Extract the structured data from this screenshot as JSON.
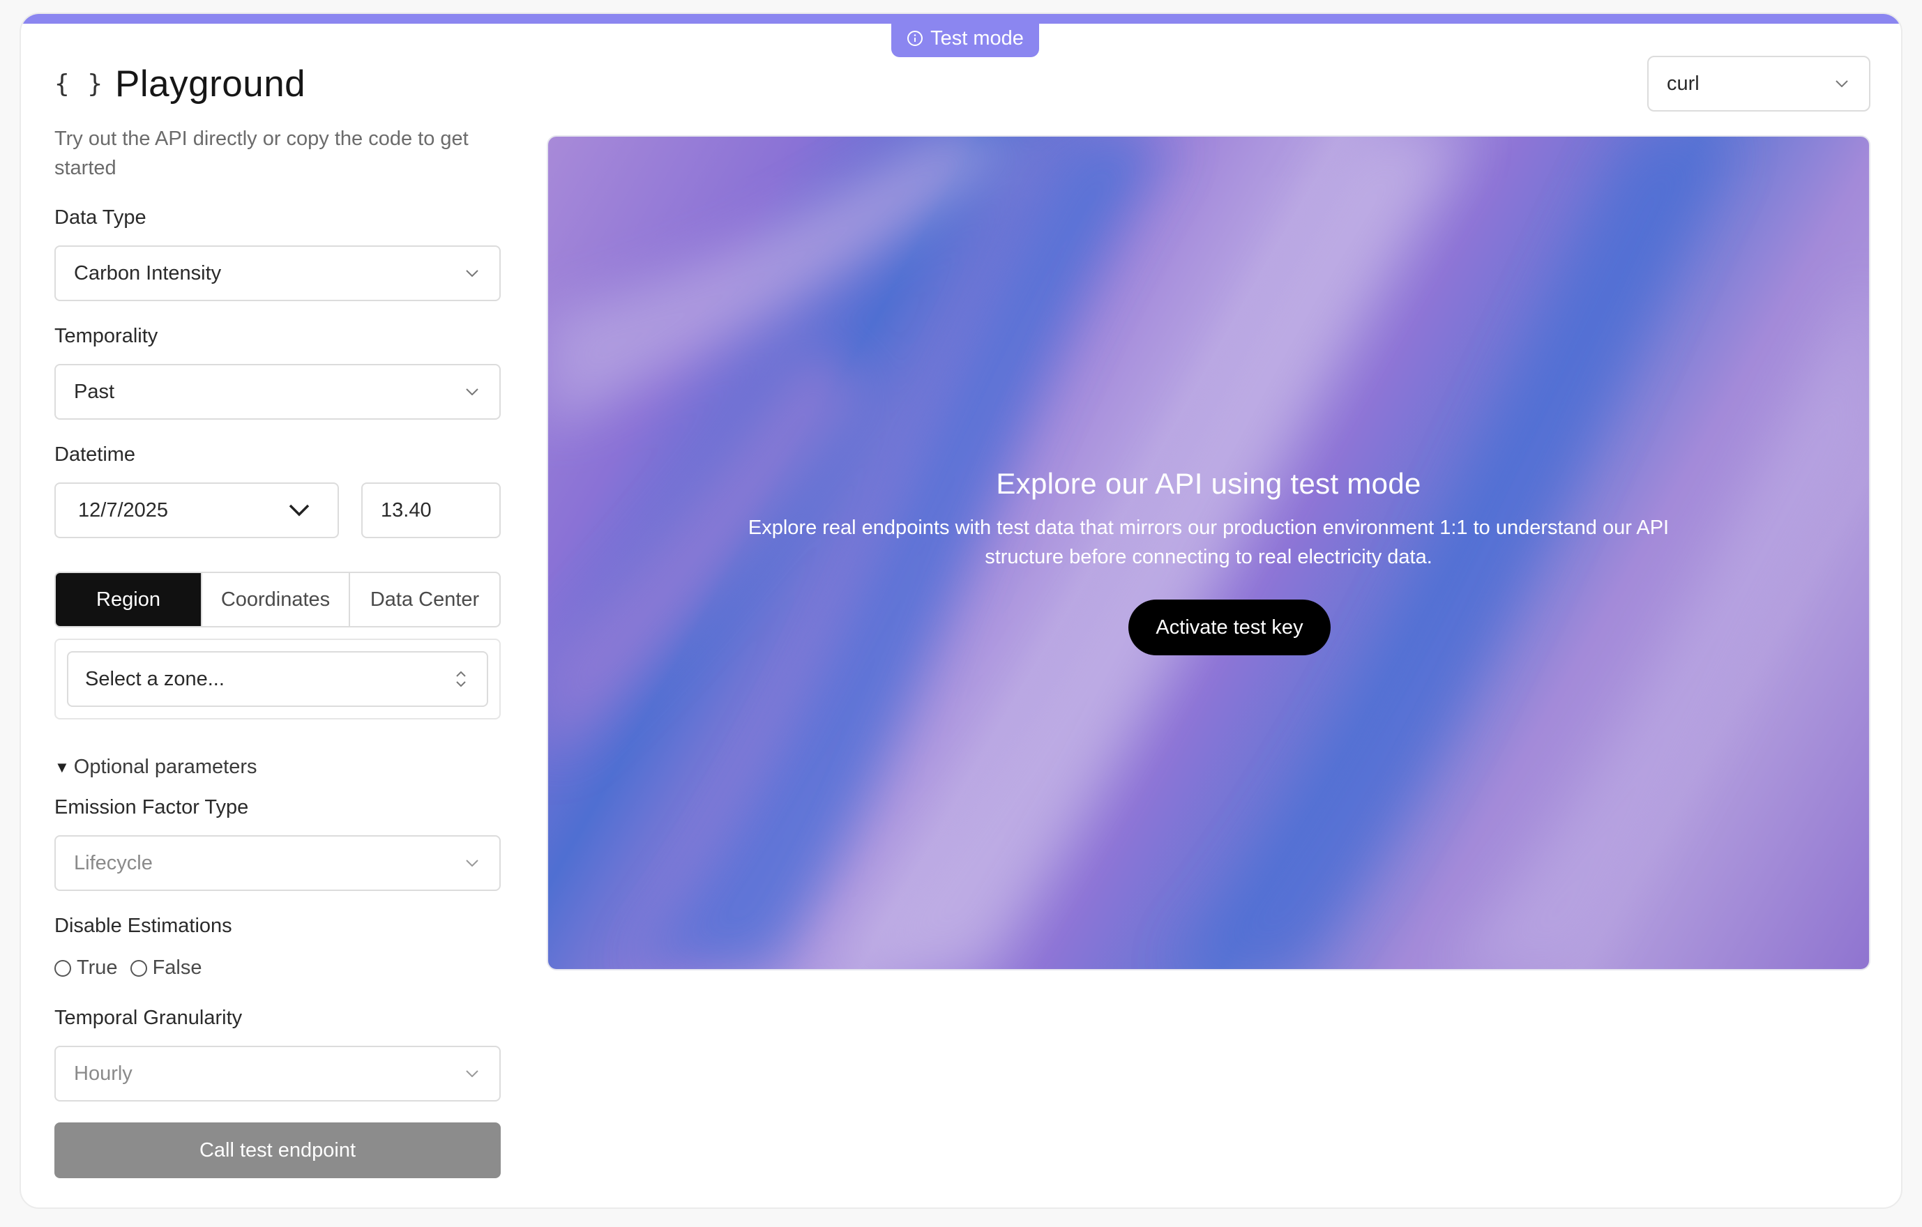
{
  "badge": {
    "label": "Test mode"
  },
  "header": {
    "title": "Playground",
    "braces": "{ }",
    "subtitle": "Try out the API directly or copy the code to get started"
  },
  "form": {
    "data_type": {
      "label": "Data Type",
      "value": "Carbon Intensity"
    },
    "temporality": {
      "label": "Temporality",
      "value": "Past"
    },
    "datetime": {
      "label": "Datetime",
      "date": "12/7/2025",
      "time": "13.40"
    },
    "location_tabs": [
      "Region",
      "Coordinates",
      "Data Center"
    ],
    "active_tab": "Region",
    "zone": {
      "placeholder": "Select a zone..."
    },
    "optional_label": "Optional parameters",
    "emission_factor": {
      "label": "Emission Factor Type",
      "value": "Lifecycle"
    },
    "disable_estimations": {
      "label": "Disable Estimations",
      "options": [
        "True",
        "False"
      ]
    },
    "granularity": {
      "label": "Temporal Granularity",
      "value": "Hourly"
    },
    "submit_label": "Call test endpoint"
  },
  "language_select": {
    "value": "curl"
  },
  "hero": {
    "title": "Explore our API using test mode",
    "description": "Explore real endpoints with test data that mirrors our production environment 1:1 to understand our API structure before connecting to real electricity data.",
    "button_label": "Activate test key"
  },
  "colors": {
    "accent": "#8b86f0",
    "primary_button": "#111111",
    "disabled_button": "#8c8c8c"
  },
  "icons": [
    "info-icon",
    "chevron-down-icon",
    "up-down-chevron-icon",
    "triangle-down-icon"
  ]
}
